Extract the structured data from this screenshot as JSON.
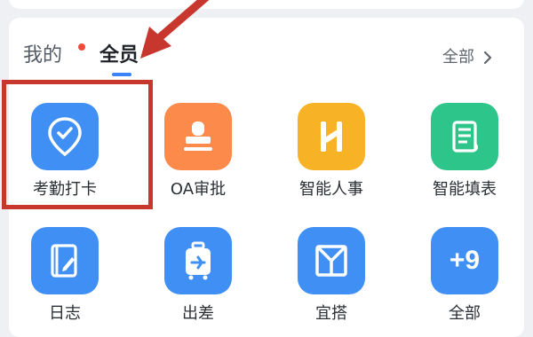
{
  "tabs": {
    "mine": "我的",
    "all": "全员",
    "active": "all"
  },
  "header": {
    "all_link": "全部"
  },
  "apps": [
    {
      "label": "考勤打卡",
      "icon": "location-check-icon",
      "color": "#3f8ff5"
    },
    {
      "label": "OA审批",
      "icon": "stamp-icon",
      "color": "#fb8a4b"
    },
    {
      "label": "智能人事",
      "icon": "h-logo-icon",
      "color": "#f7b325"
    },
    {
      "label": "智能填表",
      "icon": "scroll-form-icon",
      "color": "#2ec58b"
    },
    {
      "label": "日志",
      "icon": "journal-pen-icon",
      "color": "#3f8ff5"
    },
    {
      "label": "出差",
      "icon": "suitcase-plane-icon",
      "color": "#3f8ff5"
    },
    {
      "label": "宜搭",
      "icon": "y-block-icon",
      "color": "#3f8ff5"
    },
    {
      "label": "全部",
      "icon": "plus-nine-icon",
      "color": "#3f8ff5",
      "badge": "+9"
    }
  ],
  "annotation": {
    "highlight_color": "#c8372d"
  }
}
